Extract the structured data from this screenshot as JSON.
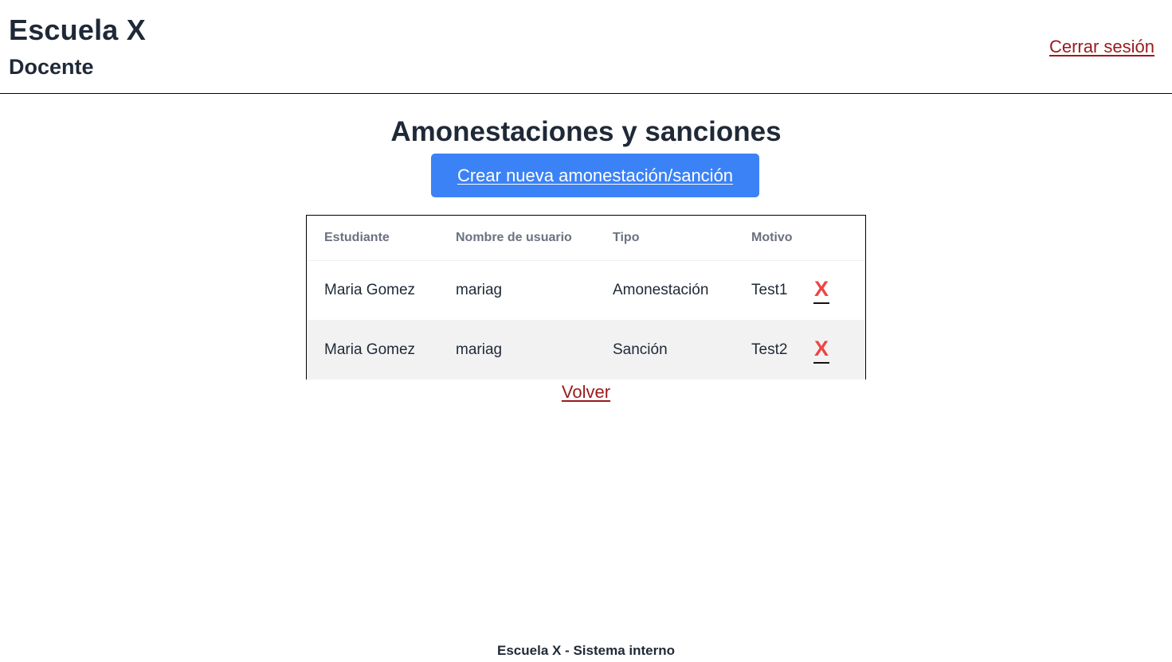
{
  "header": {
    "school_name": "Escuela X",
    "role": "Docente",
    "logout_label": "Cerrar sesión"
  },
  "main": {
    "title": "Amonestaciones y sanciones",
    "create_button_label": "Crear nueva amonestación/sanción",
    "table": {
      "columns": [
        "Estudiante",
        "Nombre de usuario",
        "Tipo",
        "Motivo"
      ],
      "rows": [
        {
          "student": "Maria Gomez",
          "username": "mariag",
          "type": "Amonestación",
          "motive": "Test1",
          "delete_label": "X"
        },
        {
          "student": "Maria Gomez",
          "username": "mariag",
          "type": "Sanción",
          "motive": "Test2",
          "delete_label": "X"
        }
      ]
    },
    "back_label": "Volver"
  },
  "footer": {
    "text": "Escuela X - Sistema interno"
  },
  "colors": {
    "primary_button": "#3b82f6",
    "link_red": "#991b1b",
    "delete_red": "#ef4444",
    "text_dark": "#1f2937",
    "header_gray": "#6b7280",
    "row_alt": "#f2f2f2"
  }
}
